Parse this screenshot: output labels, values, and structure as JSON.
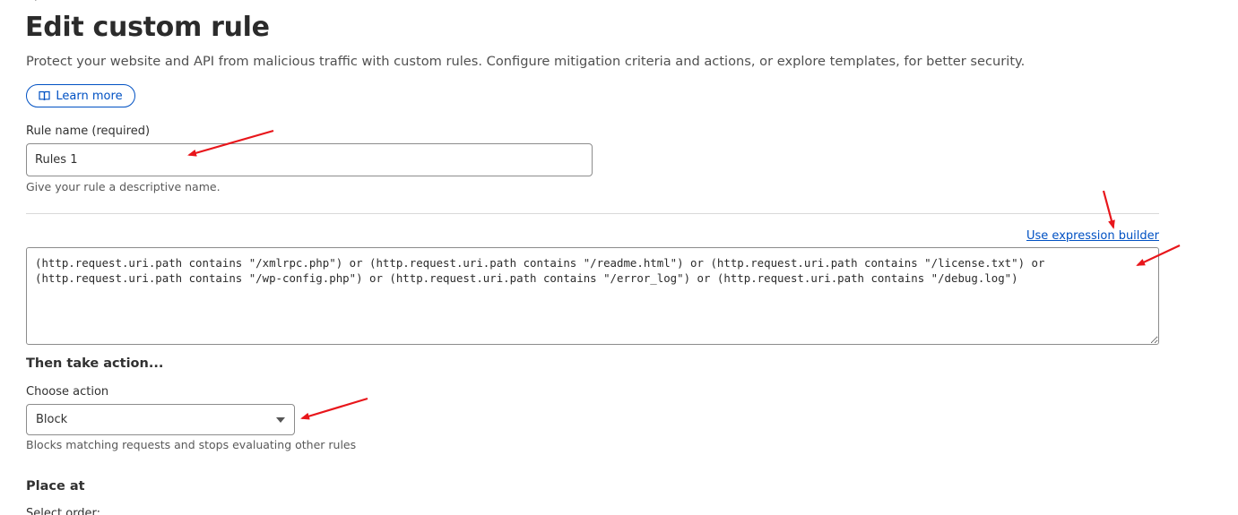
{
  "header": {
    "title": "Edit custom rule",
    "description": "Protect your website and API from malicious traffic with custom rules. Configure mitigation criteria and actions, or explore templates, for better security.",
    "learn_more_label": "Learn more",
    "learn_more_icon": "book-icon"
  },
  "rule_name": {
    "label": "Rule name (required)",
    "value": "Rules 1",
    "help": "Give your rule a descriptive name."
  },
  "expression": {
    "builder_link": "Use expression builder",
    "value": "(http.request.uri.path contains \"/xmlrpc.php\") or (http.request.uri.path contains \"/readme.html\") or (http.request.uri.path contains \"/license.txt\") or\n(http.request.uri.path contains \"/wp-config.php\") or (http.request.uri.path contains \"/error_log\") or (http.request.uri.path contains \"/debug.log\")"
  },
  "action": {
    "section_title": "Then take action...",
    "label": "Choose action",
    "selected": "Block",
    "help": "Blocks matching requests and stops evaluating other rules"
  },
  "placement": {
    "section_title": "Place at",
    "order_label": "Select order:"
  },
  "colors": {
    "accent": "#0051c3",
    "annotation_arrow": "#e8161b",
    "border": "#8c8c8c"
  }
}
